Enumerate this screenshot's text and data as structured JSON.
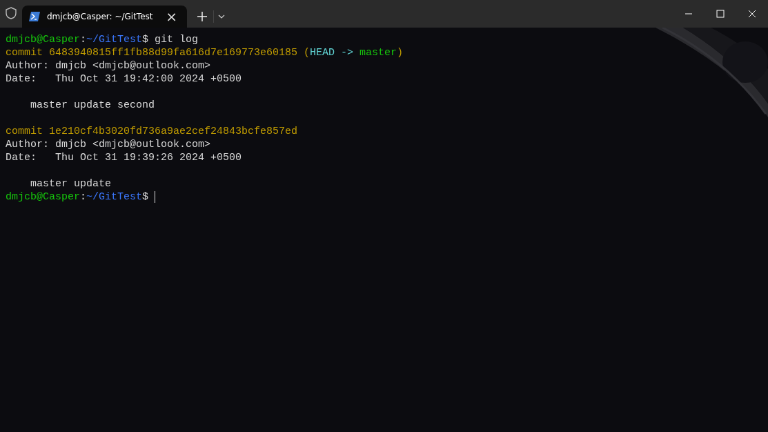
{
  "tabs": [
    {
      "title": "dmjcb@Casper: ~/GitTest",
      "selected": true,
      "close": "×"
    }
  ],
  "terminal": {
    "lines": [
      {
        "kind": "text",
        "segments": [
          {
            "text": "dmjcb@Casper",
            "kind": "user"
          },
          {
            "text": ":",
            "kind": "plain"
          },
          {
            "text": "~/GitTest",
            "kind": "path"
          },
          {
            "text": "$ git log",
            "kind": "plain"
          }
        ]
      },
      {
        "kind": "text",
        "segments": [
          {
            "text": "commit 6483940815ff1fb88d99fa616d7e169773e60185 (",
            "kind": "hash"
          },
          {
            "text": "HEAD -> ",
            "kind": "head"
          },
          {
            "text": "master",
            "kind": "branch"
          },
          {
            "text": ")",
            "kind": "hash"
          }
        ]
      },
      {
        "kind": "text",
        "segments": [
          {
            "text": "Author: dmjcb <dmjcb@outlook.com>",
            "kind": "plain"
          }
        ]
      },
      {
        "kind": "text",
        "segments": [
          {
            "text": "Date:   Thu Oct 31 19:42:00 2024 +0500",
            "kind": "plain"
          }
        ]
      },
      {
        "kind": "blank"
      },
      {
        "kind": "text",
        "segments": [
          {
            "text": "    master update second",
            "kind": "plain"
          }
        ]
      },
      {
        "kind": "blank"
      },
      {
        "kind": "text",
        "segments": [
          {
            "text": "commit 1e210cf4b3020fd736a9ae2cef24843bcfe857ed",
            "kind": "hash"
          }
        ]
      },
      {
        "kind": "text",
        "segments": [
          {
            "text": "Author: dmjcb <dmjcb@outlook.com>",
            "kind": "plain"
          }
        ]
      },
      {
        "kind": "text",
        "segments": [
          {
            "text": "Date:   Thu Oct 31 19:39:26 2024 +0500",
            "kind": "plain"
          }
        ]
      },
      {
        "kind": "blank"
      },
      {
        "kind": "text",
        "segments": [
          {
            "text": "    master update",
            "kind": "plain"
          }
        ]
      },
      {
        "kind": "text",
        "cursor": true,
        "segments": [
          {
            "text": "dmjcb@Casper",
            "kind": "user"
          },
          {
            "text": ":",
            "kind": "plain"
          },
          {
            "text": "~/GitTest",
            "kind": "path"
          },
          {
            "text": "$ ",
            "kind": "plain"
          }
        ]
      }
    ]
  }
}
